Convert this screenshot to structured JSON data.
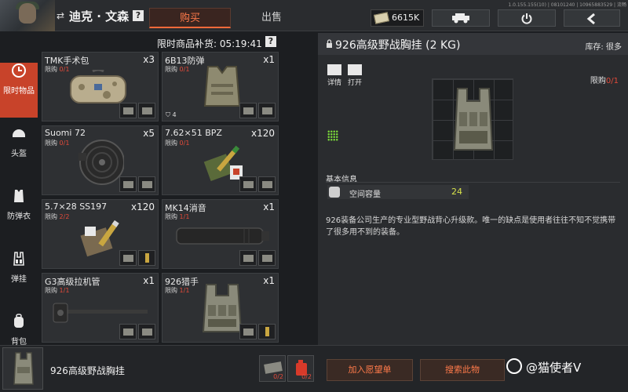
{
  "header": {
    "player_name": "迪克 · 文森",
    "help": "?",
    "tabs": [
      {
        "label": "购买",
        "active": true
      },
      {
        "label": "出售",
        "active": false
      }
    ],
    "currency": "6615K",
    "build_info": "1.0.155.155(10) | 08101240 | 10965883529 | 流畅"
  },
  "sidebar": {
    "items": [
      {
        "label": "限时物品",
        "icon": "clock-icon",
        "active": true
      },
      {
        "label": "头盔",
        "icon": "helmet-icon",
        "active": false
      },
      {
        "label": "防弹衣",
        "icon": "body-armor-icon",
        "active": false
      },
      {
        "label": "弹挂",
        "icon": "chest-rig-icon",
        "active": false
      },
      {
        "label": "背包",
        "icon": "backpack-icon",
        "active": false
      }
    ]
  },
  "restock": {
    "label": "限时商品补货: 05:19:41",
    "help": "?"
  },
  "items": [
    {
      "name": "TMK手术包",
      "limit_prefix": "限购",
      "limit_value": "0/1",
      "qty": "x3"
    },
    {
      "name": "6B13防弹",
      "limit_prefix": "限购",
      "limit_value": "0/1",
      "qty": "x1",
      "armor_level": "4"
    },
    {
      "name": "Suomi 72",
      "limit_prefix": "限购",
      "limit_value": "0/1",
      "qty": "x5"
    },
    {
      "name": "7.62×51 BPZ",
      "limit_prefix": "限购",
      "limit_value": "0/1",
      "qty": "x120"
    },
    {
      "name": "5.7×28 SS197",
      "limit_prefix": "限购",
      "limit_value": "2/2",
      "qty": "x120"
    },
    {
      "name": "MK14消音",
      "limit_prefix": "限购",
      "limit_value": "1/1",
      "qty": "x1"
    },
    {
      "name": "G3高级拉机管",
      "limit_prefix": "限购",
      "limit_value": "1/1",
      "qty": "x1"
    },
    {
      "name": "926猎手",
      "limit_prefix": "限购",
      "limit_value": "1/1",
      "qty": "x1"
    }
  ],
  "detail": {
    "title": "926高级野战胸挂 (2 KG)",
    "stock_label": "库存: 很多",
    "actions": [
      {
        "label": "详情"
      },
      {
        "label": "打开"
      }
    ],
    "limit_prefix": "限购",
    "limit_value": "0/1",
    "section_label": "基本信息",
    "stat_name": "空间容量",
    "stat_value": "24",
    "description": "926装备公司生产的专业型野战背心升级款。唯一的缺点是使用者往往不知不觉携带了很多用不到的装备。"
  },
  "bottom": {
    "selected_name": "926高级野战胸挂",
    "costs": [
      {
        "value": "0/2"
      },
      {
        "value": "0/2"
      }
    ],
    "wish_button": "加入愿望单",
    "search_button": "搜索此物",
    "watermark": "@猫使者V"
  }
}
